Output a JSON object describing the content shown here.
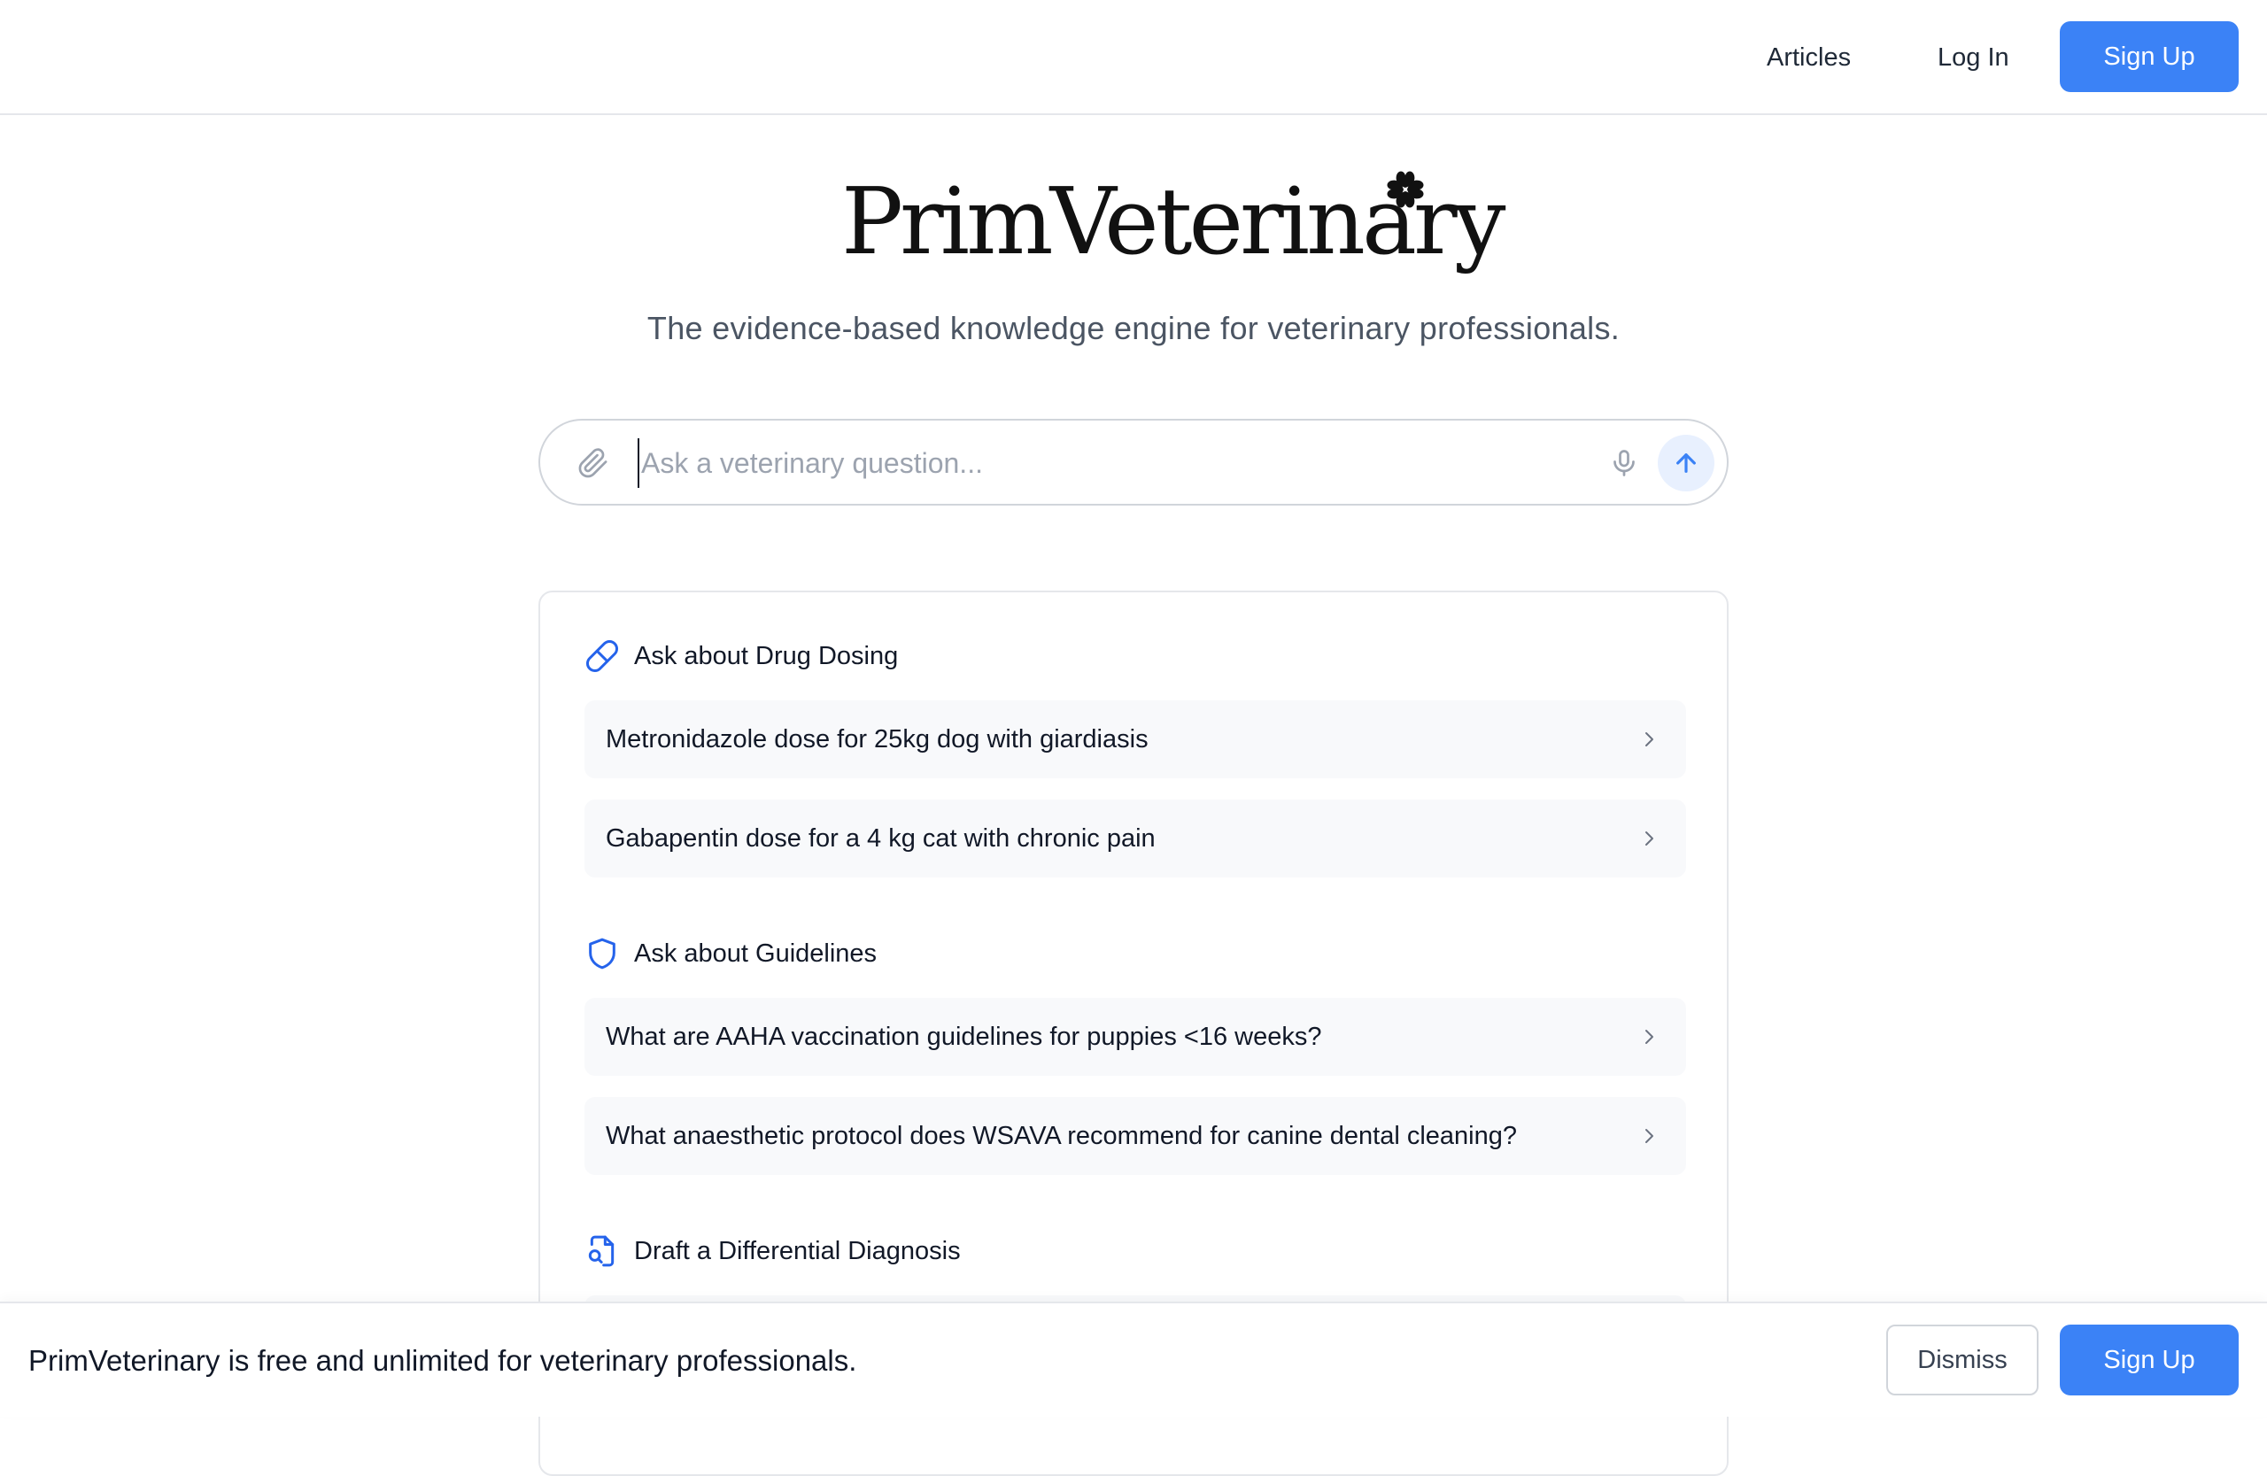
{
  "header": {
    "articles_label": "Articles",
    "login_label": "Log In",
    "signup_label": "Sign Up"
  },
  "brand": {
    "name": "PrimVeterinary",
    "tagline": "The evidence-based knowledge engine for veterinary professionals.",
    "accent_color": "#3b82f6"
  },
  "search": {
    "placeholder": "Ask a veterinary question...",
    "value": "",
    "icons": {
      "attach": "paperclip-icon",
      "mic": "microphone-icon",
      "send": "arrow-up-icon"
    }
  },
  "suggestions": {
    "sections": [
      {
        "title": "Ask about Drug Dosing",
        "icon": "pill-icon",
        "items": [
          "Metronidazole dose for 25kg dog with giardiasis",
          "Gabapentin dose for a 4 kg cat with chronic pain"
        ]
      },
      {
        "title": "Ask about Guidelines",
        "icon": "shield-icon",
        "items": [
          "What are AAHA vaccination guidelines for puppies <16 weeks?",
          "What anaesthetic protocol does WSAVA recommend for canine dental cleaning?"
        ]
      },
      {
        "title": "Draft a Differential Diagnosis",
        "icon": "document-search-icon",
        "items": []
      }
    ]
  },
  "banner": {
    "text": "PrimVeterinary is free and unlimited for veterinary professionals.",
    "dismiss_label": "Dismiss",
    "signup_label": "Sign Up"
  }
}
